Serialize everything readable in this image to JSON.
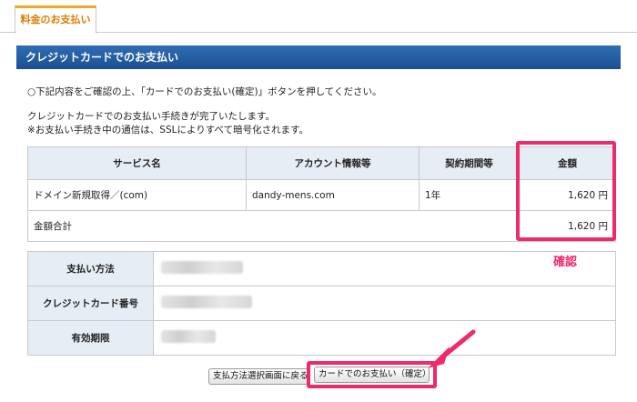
{
  "tabs": [
    {
      "label": "料金のお支払い"
    }
  ],
  "section": {
    "title": "クレジットカードでのお支払い"
  },
  "instructions": {
    "line1": "○下記内容をご確認の上、「カードでのお支払い(確定)」ボタンを押してください。",
    "line2": "クレジットカードでのお支払い手続きが完了いたします。",
    "line3": "※お支払い手続き中の通信は、SSLによりすべて暗号化されます。"
  },
  "order_table": {
    "headers": [
      "サービス名",
      "アカウント情報等",
      "契約期間等",
      "金額"
    ],
    "rows": [
      {
        "service": "ドメイン新規取得／(com)",
        "account": "dandy-mens.com",
        "period": "1年",
        "amount": "1,620 円"
      }
    ],
    "total_label": "金額合計",
    "total_amount": "1,620 円"
  },
  "payment_table": {
    "rows": [
      {
        "label": "支払い方法"
      },
      {
        "label": "クレジットカード番号"
      },
      {
        "label": "有効期限"
      }
    ]
  },
  "annotation": {
    "label": "確認",
    "color": "#ee2a6b"
  },
  "buttons": {
    "back_label": "支払方法選択画面に戻る",
    "confirm_label": "カードでのお支払い（確定）"
  },
  "colors": {
    "header_blue": "#1c4f93",
    "tab_orange": "#e07b00",
    "accent_pink": "#ee2a6b"
  }
}
